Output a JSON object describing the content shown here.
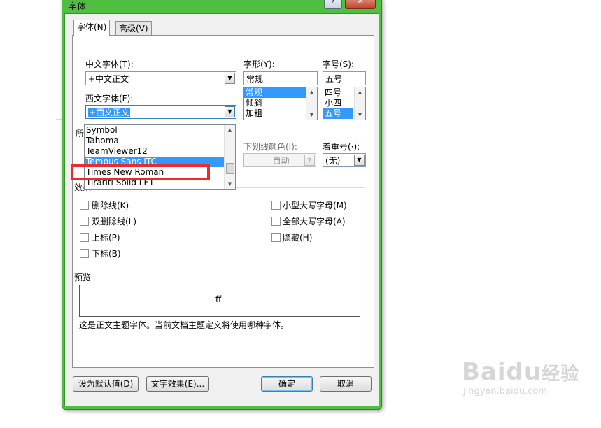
{
  "dialog": {
    "title": "字体",
    "help_btn": "?",
    "close_btn": "✕"
  },
  "tabs": [
    {
      "label": "字体(N)",
      "active": true
    },
    {
      "label": "高级(V)",
      "active": false
    }
  ],
  "chinese_font": {
    "label": "中文字体(T):",
    "value": "+中文正文"
  },
  "western_font": {
    "label": "西文字体(F):",
    "value": "+西文正文",
    "list": [
      "Symbol",
      "Tahoma",
      "TeamViewer12",
      "Tempus Sans ITC",
      "Times New Roman",
      "Tirariti Solid LET"
    ],
    "selected_index": 3,
    "highlighted": "Times New Roman"
  },
  "font_style": {
    "label": "字形(Y):",
    "value": "常规",
    "list": [
      "常规",
      "倾斜",
      "加粗"
    ],
    "selected_index": 0
  },
  "font_size": {
    "label": "字号(S):",
    "value": "五号",
    "list": [
      "四号",
      "小四",
      "五号"
    ],
    "selected_index": 2
  },
  "partial_label": "所",
  "underline_color": {
    "label": "下划线颜色(I):",
    "value": "自动"
  },
  "emphasis": {
    "label": "着重号(·):",
    "value": "(无)"
  },
  "effects": {
    "title": "效果",
    "left": [
      "删除线(K)",
      "双删除线(L)",
      "上标(P)",
      "下标(B)"
    ],
    "right": [
      "小型大写字母(M)",
      "全部大写字母(A)",
      "隐藏(H)"
    ]
  },
  "preview": {
    "title": "预览",
    "sample": "ff",
    "note": "这是正文主题字体。当前文档主题定义将使用哪种字体。"
  },
  "buttons": {
    "set_default": "设为默认值(D)",
    "text_effects": "文字效果(E)...",
    "ok": "确定",
    "cancel": "取消"
  },
  "colors": {
    "frame": "#4fbf3f",
    "selection": "#3399ff",
    "highlight_box": "#ee2b2b"
  },
  "watermark": {
    "brand": "Baidu",
    "brand_cn": "经验",
    "url": "jingyan.baidu.com"
  }
}
